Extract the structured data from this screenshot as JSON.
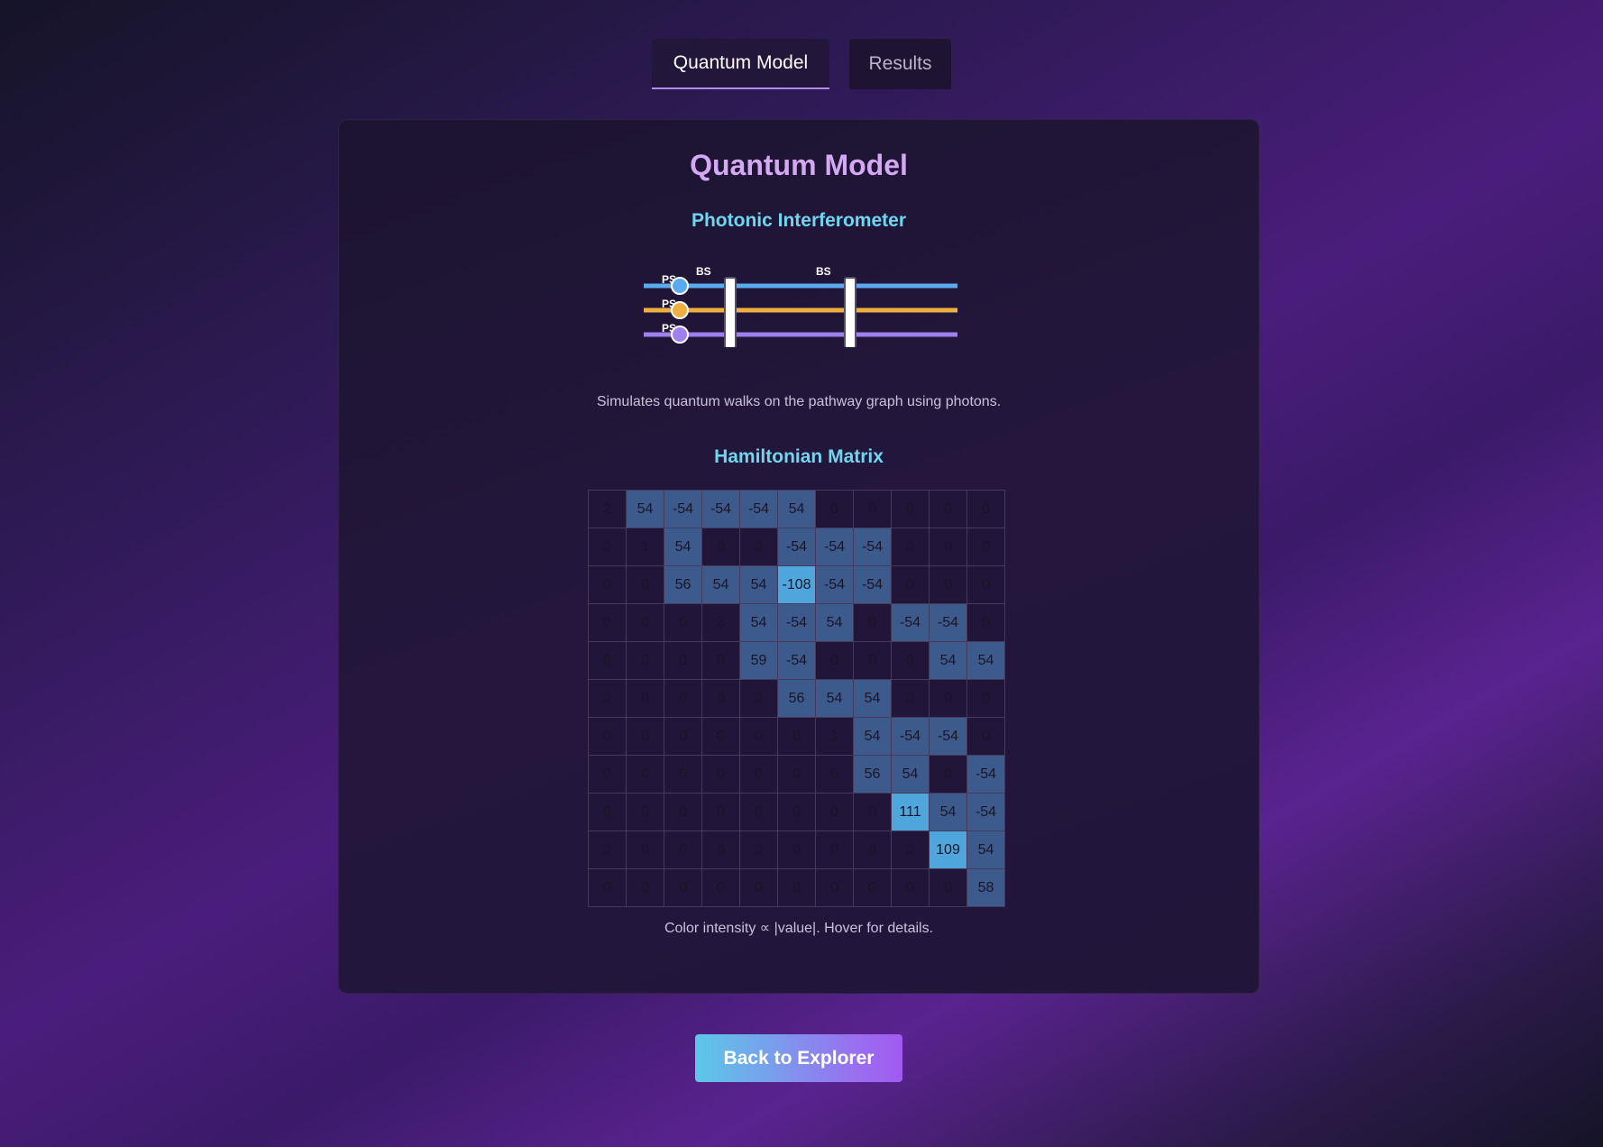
{
  "tabs": [
    {
      "label": "Quantum Model",
      "active": true
    },
    {
      "label": "Results",
      "active": false
    }
  ],
  "panel": {
    "title": "Quantum Model",
    "interferometer": {
      "heading": "Photonic Interferometer",
      "mode_colors": [
        "#5aaaf0",
        "#f0b040",
        "#a080f0"
      ],
      "phase_shifter_label": "PS",
      "beam_splitter_label": "BS",
      "description": "Simulates quantum walks on the pathway graph using photons."
    },
    "hamiltonian": {
      "heading": "Hamiltonian Matrix",
      "rows": [
        [
          2,
          54,
          -54,
          -54,
          -54,
          54,
          0,
          0,
          0,
          0,
          0
        ],
        [
          0,
          1,
          54,
          0,
          0,
          -54,
          -54,
          -54,
          0,
          0,
          0
        ],
        [
          0,
          0,
          56,
          54,
          54,
          -108,
          -54,
          -54,
          0,
          0,
          0
        ],
        [
          0,
          0,
          0,
          3,
          54,
          -54,
          54,
          0,
          -54,
          -54,
          0
        ],
        [
          0,
          0,
          0,
          0,
          59,
          -54,
          0,
          0,
          0,
          54,
          54
        ],
        [
          0,
          0,
          0,
          0,
          0,
          56,
          54,
          54,
          0,
          0,
          0
        ],
        [
          0,
          0,
          0,
          0,
          0,
          0,
          1,
          54,
          -54,
          -54,
          0
        ],
        [
          0,
          0,
          0,
          0,
          0,
          0,
          0,
          56,
          54,
          0,
          -54
        ],
        [
          0,
          0,
          0,
          0,
          0,
          0,
          0,
          0,
          111,
          54,
          -54
        ],
        [
          0,
          0,
          0,
          0,
          0,
          0,
          0,
          0,
          0,
          109,
          54
        ],
        [
          0,
          0,
          0,
          0,
          0,
          0,
          0,
          0,
          0,
          0,
          58
        ]
      ],
      "caption": "Color intensity ∝ |value|. Hover for details."
    }
  },
  "back_button": "Back to Explorer"
}
